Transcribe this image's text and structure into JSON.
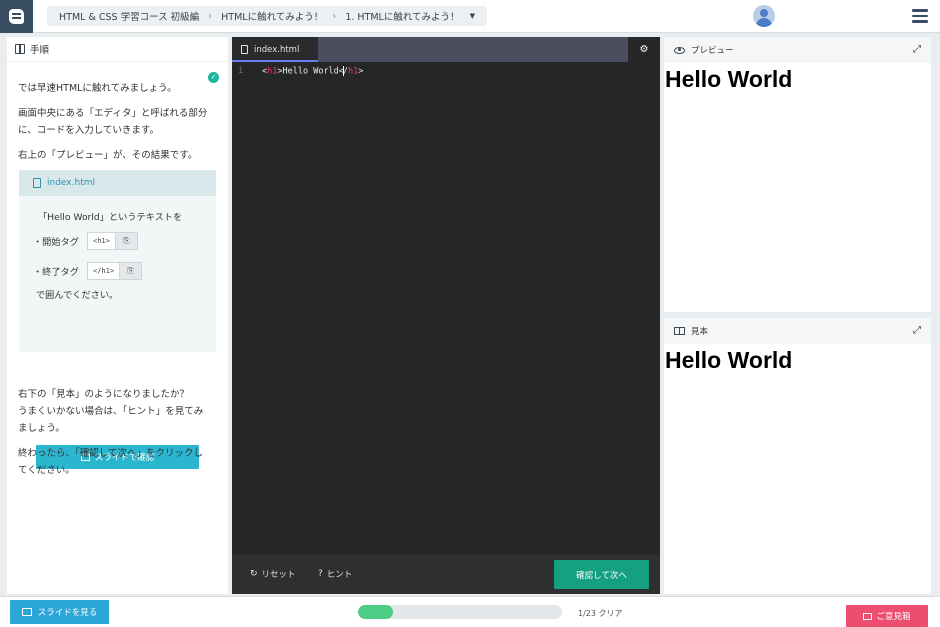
{
  "header": {
    "breadcrumb": [
      "HTML & CSS 学習コース 初級編",
      "HTMLに触れてみよう！",
      "1. HTMLに触れてみよう！"
    ]
  },
  "instructions": {
    "title": "手順",
    "paragraphs": [
      "では早速HTMLに触れてみましょう。",
      "画面中央にある「エディタ」と呼ばれる部分",
      "に、コードを入力していきます。",
      "右上の「プレビュー」が、その結果です。"
    ],
    "card": {
      "filename": "index.html",
      "line1": "「Hello World」というテキストを",
      "start_label": "・開始タグ",
      "start_tag": "<h1>",
      "end_label": "・終了タグ",
      "end_tag": "</h1>",
      "line_last": "で囲んでください。",
      "slide_button": "スライドで確認"
    },
    "after": [
      "右下の「見本」のようになりましたか？",
      "うまくいかない場合は、「ヒント」を見てみ",
      "ましょう。",
      "終わったら、「確認して次へ」をクリックし",
      "てください。"
    ]
  },
  "editor": {
    "tab": "index.html",
    "line_number": "1",
    "code": {
      "open_lt": "<",
      "open_name": "h1",
      "open_gt": ">",
      "text": "Hello World",
      "close_lt": "<",
      "close_slash": "/",
      "close_name": "h1",
      "close_gt": ">"
    },
    "reset": "リセット",
    "hint": "ヒント",
    "next": "確認して次へ"
  },
  "preview": {
    "title": "プレビュー",
    "content": "Hello World"
  },
  "model": {
    "title": "見本",
    "content": "Hello World"
  },
  "footer": {
    "slide_button": "スライドを見る",
    "progress_fraction": 0.17,
    "progress_text": "1/23 クリア",
    "feedback_button": "ご意見箱"
  },
  "colors": {
    "accent_green": "#16a082",
    "progress_green": "#4ccd85",
    "feedback_pink": "#ed4e70",
    "slide_blue": "#2ba6d6",
    "editor_bg": "#252627",
    "tag_pink": "#ee3a6c"
  }
}
